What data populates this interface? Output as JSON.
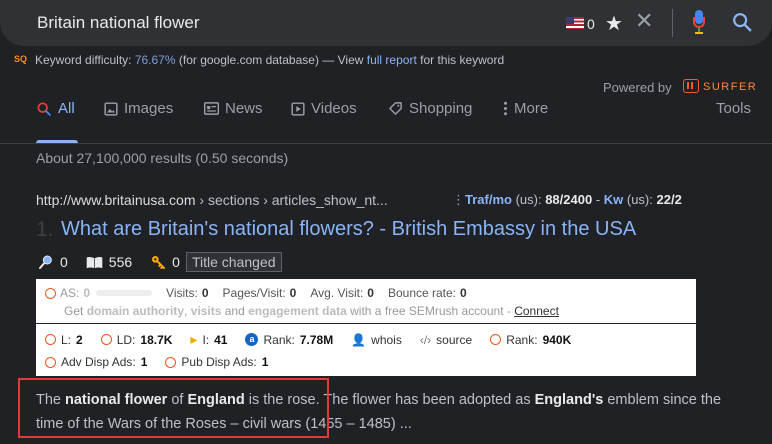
{
  "search": {
    "query": "Britain national flower",
    "flag_count": "0"
  },
  "keyword_bar": {
    "logo": "SQ",
    "label": "Keyword difficulty: ",
    "difficulty": "76.67%",
    "db": " (for google.com database) — View ",
    "link": "full report",
    "suffix": " for this keyword"
  },
  "powered": {
    "label": "Powered by",
    "brand": "SURFER"
  },
  "tabs": [
    {
      "label": "All",
      "icon": "search-icon",
      "active": true
    },
    {
      "label": "Images",
      "icon": "image-icon"
    },
    {
      "label": "News",
      "icon": "newspaper-icon"
    },
    {
      "label": "Videos",
      "icon": "play-icon"
    },
    {
      "label": "Shopping",
      "icon": "tag-icon"
    },
    {
      "label": "More",
      "icon": "kebab-icon"
    }
  ],
  "tools_label": "Tools",
  "stats": "About 27,100,000 results (0.50 seconds)",
  "result": {
    "url": "http://www.britainusa.com",
    "breadcrumb": " › sections › articles_show_nt...",
    "traf_label": "Traf/mo",
    "traf_us": " (us): ",
    "traf_value": "88/2400",
    "kw_label": "Kw",
    "kw_us": " (us): ",
    "kw_value": "22/2",
    "number": "1.",
    "title": "What are Britain's national flowers? - British Embassy in the USA",
    "metrics": {
      "search_count": "0",
      "book_count": "556",
      "key_count": "0",
      "badge": "Title changed"
    }
  },
  "semrush": {
    "as_label": "AS:",
    "as_value": "0",
    "visits_label": "Visits:",
    "visits_value": "0",
    "ppv_label": "Pages/Visit:",
    "ppv_value": "0",
    "avg_label": "Avg. Visit:",
    "avg_value": "0",
    "bounce_label": "Bounce rate:",
    "bounce_value": "0",
    "promo_pre": "Get ",
    "promo_b1": "domain authority",
    "promo_m1": ", ",
    "promo_b2": "visits",
    "promo_m2": " and ",
    "promo_b3": "engagement data",
    "promo_post": " with a free SEMrush account - ",
    "connect": "Connect"
  },
  "seo": {
    "l_label": "L:",
    "l_value": "2",
    "ld_label": "LD:",
    "ld_value": "18.7K",
    "i_label": "I:",
    "i_value": "41",
    "rank_label": "Rank:",
    "rank_value": "7.78M",
    "whois": "whois",
    "source": "source",
    "rank2_label": "Rank:",
    "rank2_value": "940K",
    "adv_label": "Adv Disp Ads:",
    "adv_value": "1",
    "pub_label": "Pub Disp Ads:",
    "pub_value": "1"
  },
  "snippet": {
    "t1": "The ",
    "b1": "national flower",
    "t2": " of ",
    "b2": "England",
    "t3": " is the rose. The flower has been adopted as ",
    "b3": "England's",
    "t4": " emblem since the time of the Wars of the Roses – civil wars (1455 – 1485) ..."
  }
}
